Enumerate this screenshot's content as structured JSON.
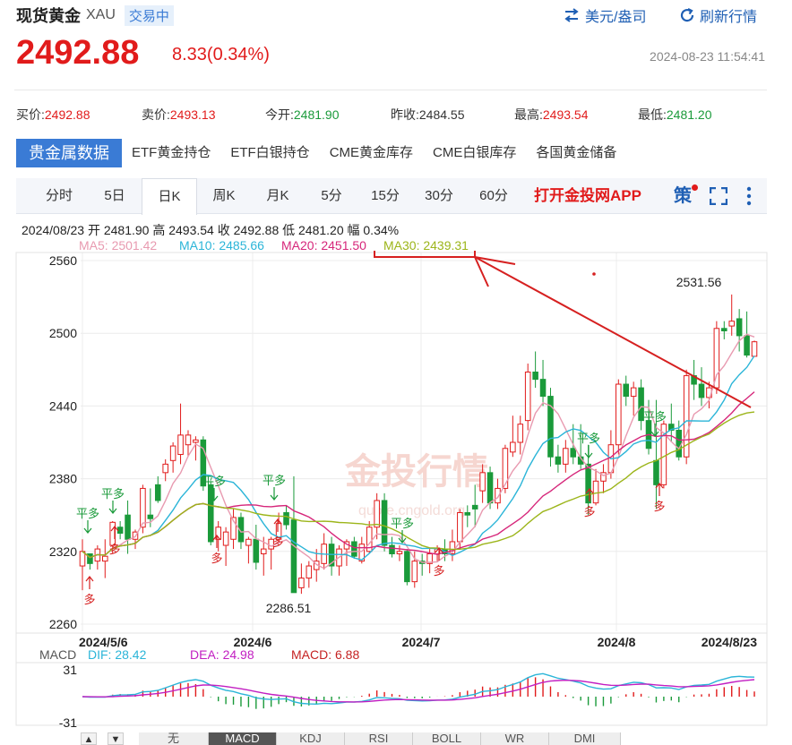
{
  "header": {
    "name": "现货黄金",
    "code": "XAU",
    "status": "交易中",
    "currency_btn": "美元/盎司",
    "refresh_btn": "刷新行情",
    "price": "2492.88",
    "change": "8.33(0.34%)",
    "timestamp": "2024-08-23 11:54:41"
  },
  "quotes": [
    {
      "label": "买价:",
      "value": "2492.88",
      "color": "red"
    },
    {
      "label": "卖价:",
      "value": "2493.13",
      "color": "red"
    },
    {
      "label": "今开:",
      "value": "2481.90",
      "color": "green"
    },
    {
      "label": "昨收:",
      "value": "2484.55",
      "color": "plain"
    },
    {
      "label": "最高:",
      "value": "2493.54",
      "color": "red"
    },
    {
      "label": "最低:",
      "value": "2481.20",
      "color": "green"
    }
  ],
  "tabs": [
    "贵金属数据",
    "ETF黄金持仓",
    "ETF白银持仓",
    "CME黄金库存",
    "CME白银库存",
    "各国黄金储备"
  ],
  "periods": [
    "分时",
    "5日",
    "日K",
    "周K",
    "月K",
    "5分",
    "15分",
    "30分",
    "60分"
  ],
  "app_link": "打开金投网APP",
  "strategy_icon": "策",
  "info_line": "2024/08/23  开 2481.90  高 2493.54  收 2492.88  低 2481.20  幅 0.34%",
  "ma_labels": {
    "ma5": "MA5: 2501.42",
    "ma10": "MA10: 2485.66",
    "ma20": "MA20: 2451.50",
    "ma30": "MA30: 2439.31"
  },
  "colors": {
    "up": "#e11b1b",
    "down": "#1a9a3a",
    "ma5": "#e89ab0",
    "ma10": "#2bb5d8",
    "ma20": "#d6267a",
    "ma30": "#9cb51a",
    "accent": "#3a7bd5"
  },
  "annotations": {
    "high_label": "2531.56",
    "low_label": "2286.51",
    "buy_tag": "多",
    "flat_tag": "平多",
    "watermark": "金投行情",
    "watermark_url": "quote.cngold.org"
  },
  "chart_data": {
    "type": "candlestick",
    "yticks": [
      "2560",
      "2500",
      "2440",
      "2380",
      "2320",
      "2260"
    ],
    "xticks": [
      "2024/5/6",
      "2024/6",
      "2024/7",
      "2024/8",
      "2024/8/23"
    ],
    "ylim": [
      2260,
      2560
    ],
    "candles": [
      [
        2308,
        2330,
        2288,
        2320
      ],
      [
        2318,
        2315,
        2305,
        2310
      ],
      [
        2312,
        2325,
        2305,
        2322
      ],
      [
        2312,
        2330,
        2298,
        2316
      ],
      [
        2325,
        2345,
        2318,
        2344
      ],
      [
        2340,
        2345,
        2330,
        2335
      ],
      [
        2350,
        2362,
        2318,
        2330
      ],
      [
        2330,
        2338,
        2322,
        2336
      ],
      [
        2340,
        2375,
        2335,
        2372
      ],
      [
        2350,
        2372,
        2340,
        2347
      ],
      [
        2375,
        2382,
        2360,
        2362
      ],
      [
        2385,
        2396,
        2378,
        2392
      ],
      [
        2395,
        2410,
        2385,
        2407
      ],
      [
        2400,
        2442,
        2392,
        2416
      ],
      [
        2408,
        2420,
        2398,
        2416
      ],
      [
        2410,
        2415,
        2395,
        2412
      ],
      [
        2412,
        2415,
        2370,
        2374
      ],
      [
        2375,
        2378,
        2325,
        2328
      ],
      [
        2330,
        2345,
        2320,
        2340
      ],
      [
        2325,
        2340,
        2308,
        2336
      ],
      [
        2330,
        2355,
        2322,
        2348
      ],
      [
        2348,
        2352,
        2322,
        2328
      ],
      [
        2325,
        2332,
        2310,
        2330
      ],
      [
        2330,
        2342,
        2305,
        2311
      ],
      [
        2318,
        2332,
        2300,
        2322
      ],
      [
        2322,
        2332,
        2305,
        2330
      ],
      [
        2330,
        2352,
        2328,
        2343
      ],
      [
        2352,
        2358,
        2338,
        2342
      ],
      [
        2346,
        2382,
        2290,
        2286
      ],
      [
        2290,
        2310,
        2285,
        2298
      ],
      [
        2298,
        2312,
        2290,
        2308
      ],
      [
        2305,
        2322,
        2295,
        2312
      ],
      [
        2310,
        2335,
        2305,
        2326
      ],
      [
        2326,
        2332,
        2300,
        2308
      ],
      [
        2308,
        2325,
        2300,
        2322
      ],
      [
        2322,
        2330,
        2308,
        2328
      ],
      [
        2328,
        2332,
        2314,
        2316
      ],
      [
        2312,
        2332,
        2310,
        2326
      ],
      [
        2320,
        2345,
        2318,
        2340
      ],
      [
        2340,
        2368,
        2330,
        2362
      ],
      [
        2362,
        2368,
        2320,
        2325
      ],
      [
        2325,
        2332,
        2315,
        2318
      ],
      [
        2318,
        2325,
        2312,
        2320
      ],
      [
        2320,
        2322,
        2292,
        2295
      ],
      [
        2295,
        2320,
        2290,
        2312
      ],
      [
        2312,
        2318,
        2300,
        2310
      ],
      [
        2310,
        2322,
        2302,
        2318
      ],
      [
        2318,
        2325,
        2312,
        2322
      ],
      [
        2322,
        2330,
        2312,
        2318
      ],
      [
        2318,
        2338,
        2312,
        2328
      ],
      [
        2328,
        2355,
        2322,
        2352
      ],
      [
        2352,
        2358,
        2340,
        2350
      ],
      [
        2358,
        2375,
        2340,
        2355
      ],
      [
        2370,
        2392,
        2360,
        2385
      ],
      [
        2385,
        2390,
        2355,
        2360
      ],
      [
        2360,
        2380,
        2355,
        2372
      ],
      [
        2372,
        2408,
        2368,
        2405
      ],
      [
        2402,
        2432,
        2398,
        2410
      ],
      [
        2410,
        2432,
        2400,
        2425
      ],
      [
        2428,
        2475,
        2420,
        2468
      ],
      [
        2468,
        2485,
        2455,
        2462
      ],
      [
        2462,
        2478,
        2440,
        2448
      ],
      [
        2448,
        2455,
        2390,
        2398
      ],
      [
        2398,
        2408,
        2385,
        2392
      ],
      [
        2392,
        2412,
        2385,
        2405
      ],
      [
        2405,
        2425,
        2392,
        2398
      ],
      [
        2398,
        2425,
        2388,
        2392
      ],
      [
        2392,
        2408,
        2350,
        2360
      ],
      [
        2360,
        2388,
        2358,
        2378
      ],
      [
        2378,
        2392,
        2368,
        2385
      ],
      [
        2385,
        2420,
        2380,
        2408
      ],
      [
        2408,
        2462,
        2400,
        2458
      ],
      [
        2458,
        2465,
        2440,
        2448
      ],
      [
        2448,
        2460,
        2432,
        2455
      ],
      [
        2455,
        2462,
        2420,
        2428
      ],
      [
        2428,
        2445,
        2400,
        2405
      ],
      [
        2395,
        2445,
        2355,
        2375
      ],
      [
        2375,
        2428,
        2372,
        2425
      ],
      [
        2425,
        2442,
        2410,
        2420
      ],
      [
        2420,
        2428,
        2395,
        2398
      ],
      [
        2398,
        2470,
        2392,
        2465
      ],
      [
        2465,
        2478,
        2445,
        2458
      ],
      [
        2458,
        2472,
        2440,
        2447
      ],
      [
        2447,
        2460,
        2438,
        2455
      ],
      [
        2455,
        2510,
        2450,
        2504
      ],
      [
        2504,
        2510,
        2495,
        2502
      ],
      [
        2506,
        2532,
        2498,
        2510
      ],
      [
        2512,
        2520,
        2485,
        2498
      ],
      [
        2498,
        2518,
        2480,
        2482
      ],
      [
        2481,
        2494,
        2481,
        2493
      ]
    ]
  },
  "macd": {
    "label": "MACD",
    "dif": "DIF: 28.42",
    "dea": "DEA: 24.98",
    "macd": "MACD: 6.88",
    "ytop": "31",
    "ybot": "-31"
  },
  "bottom_tabs": [
    "无",
    "MACD",
    "KDJ",
    "RSI",
    "BOLL",
    "WR",
    "DMI"
  ]
}
